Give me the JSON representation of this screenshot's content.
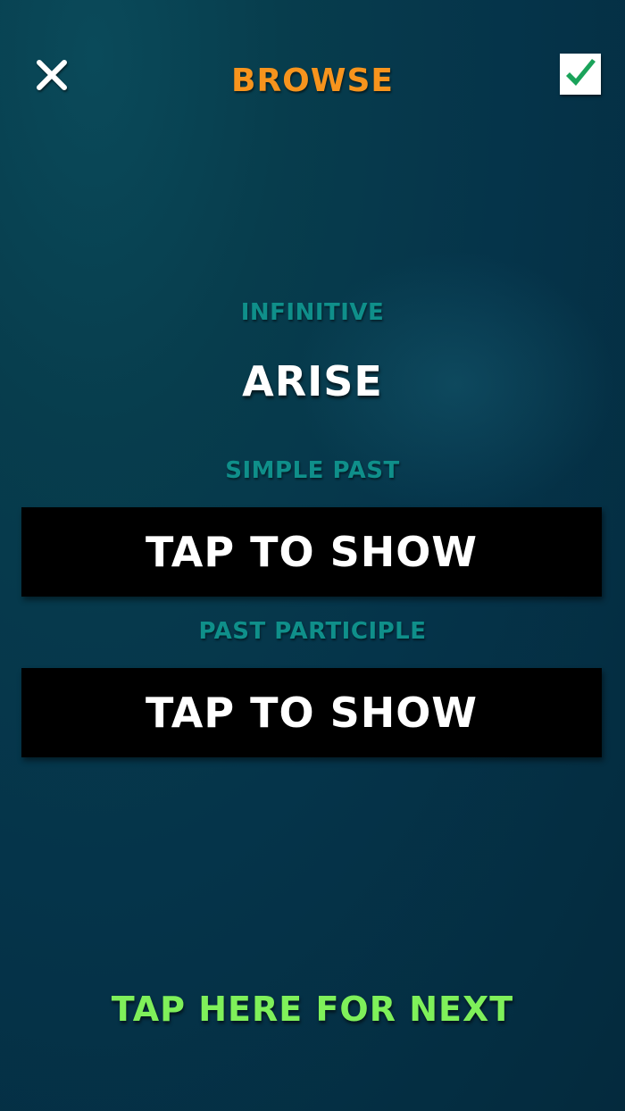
{
  "header": {
    "title": "BROWSE",
    "close_icon": "close-icon",
    "confirm_icon": "checkmark-icon"
  },
  "card": {
    "infinitive_label": "INFINITIVE",
    "infinitive_value": "ARISE",
    "simple_past_label": "SIMPLE PAST",
    "simple_past_button": "TAP TO SHOW",
    "past_participle_label": "PAST PARTICIPLE",
    "past_participle_button": "TAP TO SHOW"
  },
  "footer": {
    "next_label": "TAP HERE FOR NEXT"
  },
  "colors": {
    "title": "#f7941d",
    "label": "#0f8f8a",
    "next": "#7ff05a",
    "check": "#1aa35a",
    "background": "#05344a"
  }
}
